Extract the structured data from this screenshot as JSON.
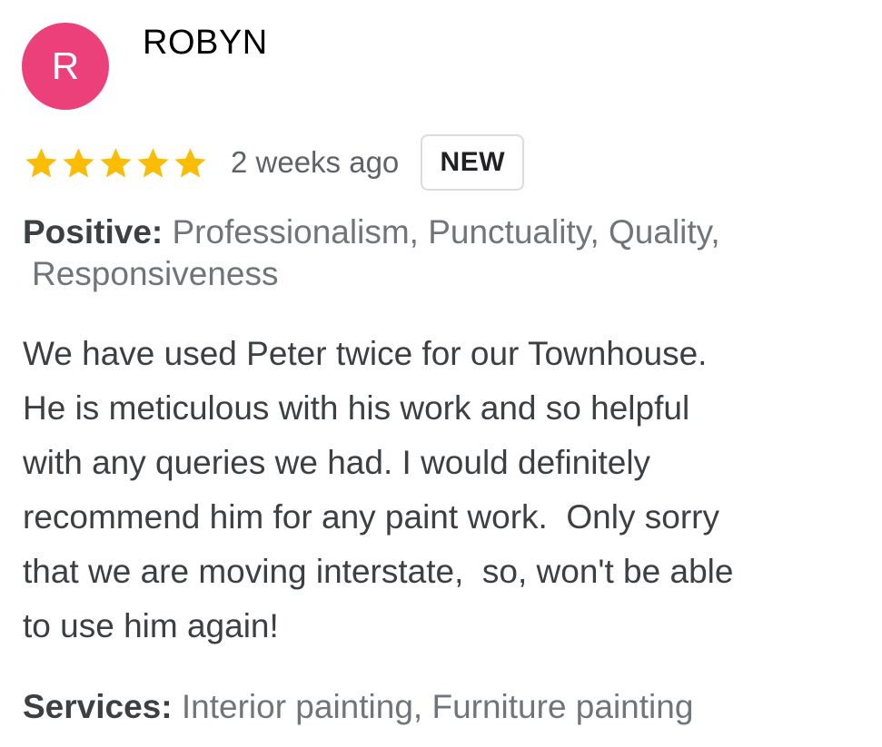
{
  "reviewer": {
    "initial": "R",
    "name": "ROBYN",
    "avatar_color": "#ec407a"
  },
  "rating": {
    "stars": 5,
    "max": 5,
    "star_color": "#fbbc04"
  },
  "date": "2 weeks ago",
  "badge": "NEW",
  "positive": {
    "label": "Positive:",
    "line1": "Professionalism, Punctuality, Quality,",
    "line2": "Responsiveness"
  },
  "review": {
    "lines": [
      "We have used Peter twice for our Townhouse.",
      "He is meticulous with his work and so helpful",
      "with any queries we had. I would definitely",
      "recommend him for any paint work.  Only sorry",
      "that we are moving interstate,  so, won't be able",
      "to use him again!"
    ]
  },
  "services": {
    "label": "Services:",
    "value": "Interior painting, Furniture painting"
  }
}
